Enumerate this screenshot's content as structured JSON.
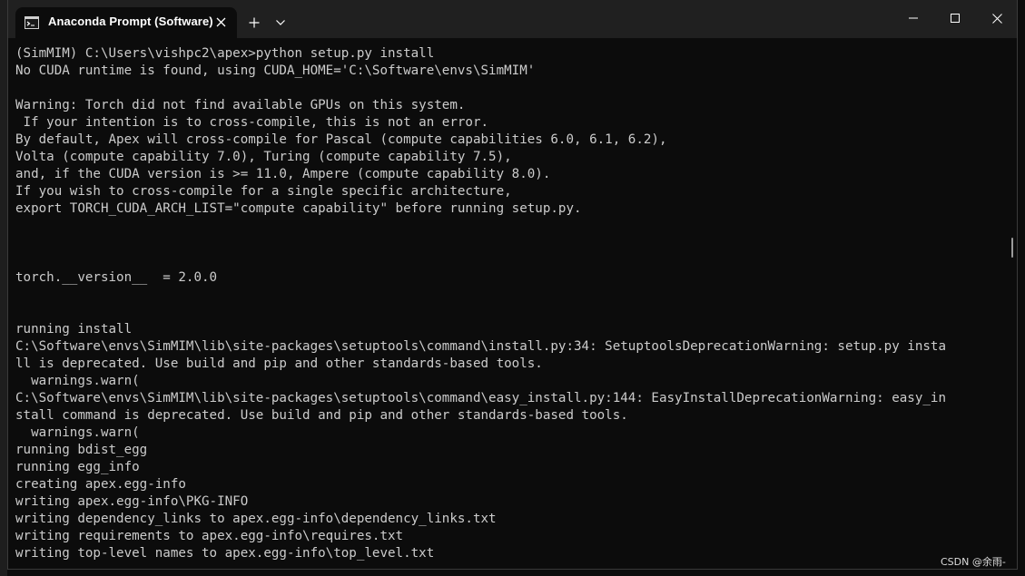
{
  "tab": {
    "title": "Anaconda Prompt (Software)",
    "icon": "terminal-icon",
    "close_icon": "close-icon"
  },
  "titlebar": {
    "new_tab_icon": "plus-icon",
    "dropdown_icon": "chevron-down-icon",
    "minimize_icon": "minimize-icon",
    "maximize_icon": "maximize-icon",
    "close_icon": "close-icon"
  },
  "terminal": {
    "lines": [
      "(SimMIM) C:\\Users\\vishpc2\\apex>python setup.py install",
      "No CUDA runtime is found, using CUDA_HOME='C:\\Software\\envs\\SimMIM'",
      "",
      "Warning: Torch did not find available GPUs on this system.",
      " If your intention is to cross-compile, this is not an error.",
      "By default, Apex will cross-compile for Pascal (compute capabilities 6.0, 6.1, 6.2),",
      "Volta (compute capability 7.0), Turing (compute capability 7.5),",
      "and, if the CUDA version is >= 11.0, Ampere (compute capability 8.0).",
      "If you wish to cross-compile for a single specific architecture,",
      "export TORCH_CUDA_ARCH_LIST=\"compute capability\" before running setup.py.",
      "",
      "",
      "",
      "torch.__version__  = 2.0.0",
      "",
      "",
      "running install",
      "C:\\Software\\envs\\SimMIM\\lib\\site-packages\\setuptools\\command\\install.py:34: SetuptoolsDeprecationWarning: setup.py insta",
      "ll is deprecated. Use build and pip and other standards-based tools.",
      "  warnings.warn(",
      "C:\\Software\\envs\\SimMIM\\lib\\site-packages\\setuptools\\command\\easy_install.py:144: EasyInstallDeprecationWarning: easy_in",
      "stall command is deprecated. Use build and pip and other standards-based tools.",
      "  warnings.warn(",
      "running bdist_egg",
      "running egg_info",
      "creating apex.egg-info",
      "writing apex.egg-info\\PKG-INFO",
      "writing dependency_links to apex.egg-info\\dependency_links.txt",
      "writing requirements to apex.egg-info\\requires.txt",
      "writing top-level names to apex.egg-info\\top_level.txt"
    ]
  },
  "watermark": "CSDN @余雨-",
  "colors": {
    "terminal_bg": "#0c0c0c",
    "terminal_text": "#cccccc",
    "titlebar_bg": "#202020"
  }
}
